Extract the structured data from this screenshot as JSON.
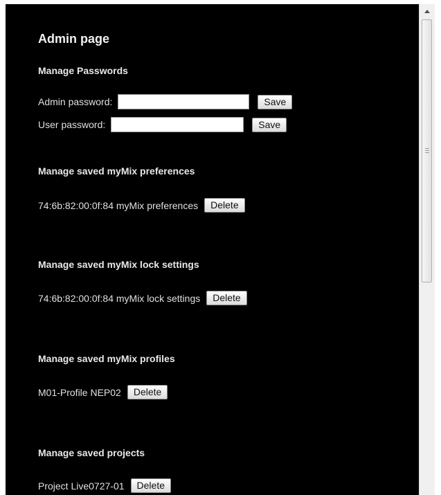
{
  "page": {
    "title": "Admin page"
  },
  "passwords": {
    "heading": "Manage Passwords",
    "admin_label": "Admin password:",
    "admin_value": "",
    "admin_save": "Save",
    "user_label": "User password:",
    "user_value": "",
    "user_save": "Save"
  },
  "preferences": {
    "heading": "Manage saved myMix preferences",
    "items": [
      {
        "label": "74:6b:82:00:0f:84 myMix preferences",
        "delete": "Delete"
      }
    ]
  },
  "lock_settings": {
    "heading": "Manage saved myMix lock settings",
    "items": [
      {
        "label": "74:6b:82:00:0f:84 myMix lock settings",
        "delete": "Delete"
      }
    ]
  },
  "profiles": {
    "heading": "Manage saved myMix profiles",
    "items": [
      {
        "label": "M01-Profile NEP02",
        "delete": "Delete"
      }
    ]
  },
  "projects": {
    "heading": "Manage saved projects",
    "items": [
      {
        "label": "Project Live0727-01",
        "delete": "Delete"
      }
    ]
  },
  "icons": {
    "scroll_up": "scroll-up-arrow-icon",
    "grip": "scrollbar-grip-icon"
  },
  "colors": {
    "background": "#000000",
    "text": "#e6e6e6"
  }
}
